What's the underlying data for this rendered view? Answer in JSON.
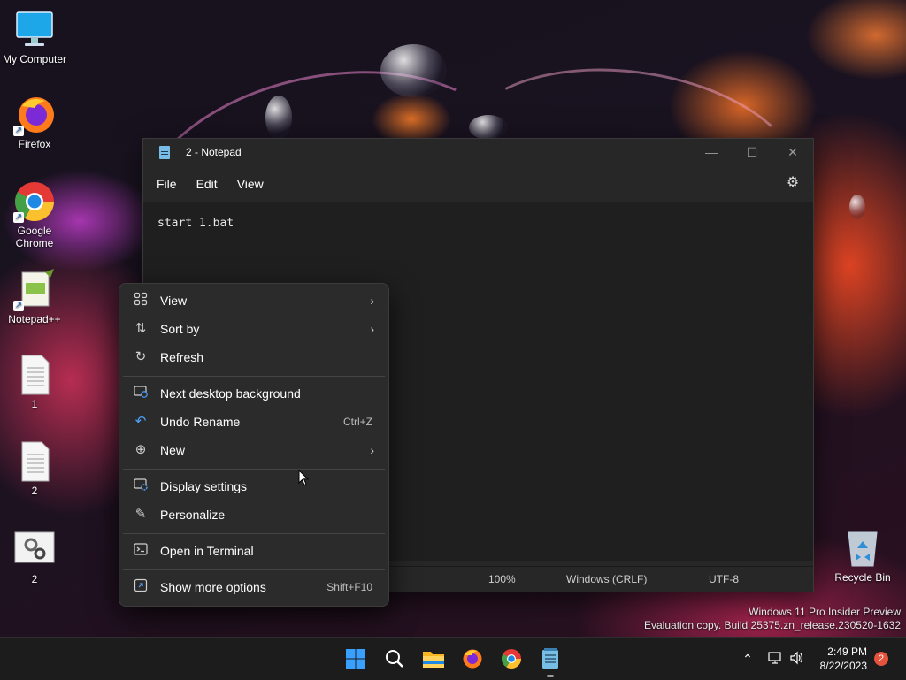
{
  "desktop": {
    "icons": [
      {
        "label": "My Computer"
      },
      {
        "label": "Firefox"
      },
      {
        "label": "Google Chrome"
      },
      {
        "label": "Notepad++"
      },
      {
        "label": "1"
      },
      {
        "label": "2"
      },
      {
        "label": "2"
      },
      {
        "label": "Recycle Bin"
      }
    ]
  },
  "notepad": {
    "title": "2 - Notepad",
    "menu": {
      "file": "File",
      "edit": "Edit",
      "view": "View"
    },
    "content": "start 1.bat",
    "status": {
      "zoom": "100%",
      "line_ending": "Windows (CRLF)",
      "encoding": "UTF-8"
    }
  },
  "context_menu": {
    "items": [
      {
        "label": "View",
        "icon": "grid-icon",
        "submenu": true
      },
      {
        "label": "Sort by",
        "icon": "sort-icon",
        "submenu": true
      },
      {
        "label": "Refresh",
        "icon": "refresh-icon"
      },
      {
        "label": "Next desktop background",
        "icon": "desktop-background-icon"
      },
      {
        "label": "Undo Rename",
        "icon": "undo-icon",
        "shortcut": "Ctrl+Z"
      },
      {
        "label": "New",
        "icon": "plus-circle-icon",
        "submenu": true
      },
      {
        "label": "Display settings",
        "icon": "display-settings-icon"
      },
      {
        "label": "Personalize",
        "icon": "pen-icon"
      },
      {
        "label": "Open in Terminal",
        "icon": "terminal-icon"
      },
      {
        "label": "Show more options",
        "icon": "expand-icon",
        "shortcut": "Shift+F10"
      }
    ]
  },
  "watermark": {
    "line1": "Windows 11 Pro Insider Preview",
    "line2": "Evaluation copy. Build 25375.zn_release.230520-1632"
  },
  "taskbar": {
    "apps": [
      "start-icon",
      "search-icon",
      "file-explorer-icon",
      "firefox-icon",
      "chrome-icon",
      "notepad-icon"
    ],
    "time": "2:49 PM",
    "date": "8/22/2023",
    "notification_count": "2"
  },
  "colors": {
    "accent": "#0078d4",
    "menu_bg": "#2b2b2b",
    "notepad_bg": "#1f1f1f",
    "taskbar_bg": "#1c1c1c"
  }
}
